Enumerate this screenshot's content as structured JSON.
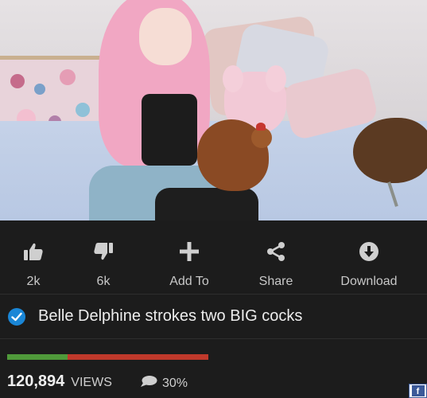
{
  "actions": {
    "like": {
      "label": "2k",
      "icon": "thumbs-up-icon"
    },
    "dislike": {
      "label": "6k",
      "icon": "thumbs-down-icon"
    },
    "add_to": {
      "label": "Add To",
      "icon": "plus-icon"
    },
    "share": {
      "label": "Share",
      "icon": "share-icon"
    },
    "download": {
      "label": "Download",
      "icon": "download-icon"
    }
  },
  "video": {
    "title": "Belle Delphine strokes two BIG cocks",
    "verified_icon": "verified-check-icon",
    "views_count": "120,894",
    "views_label": "VIEWS",
    "rating_percent": "30%",
    "rating_fraction": 0.3,
    "comment_icon": "speech-bubble-icon"
  },
  "colors": {
    "background": "#1c1c1c",
    "like_green": "#4f9a3a",
    "dislike_red": "#c0392b",
    "verified_blue": "#1a86d6",
    "facebook_blue": "#3b5998"
  },
  "facebook_badge": {
    "text": "f",
    "icon": "facebook-icon"
  }
}
